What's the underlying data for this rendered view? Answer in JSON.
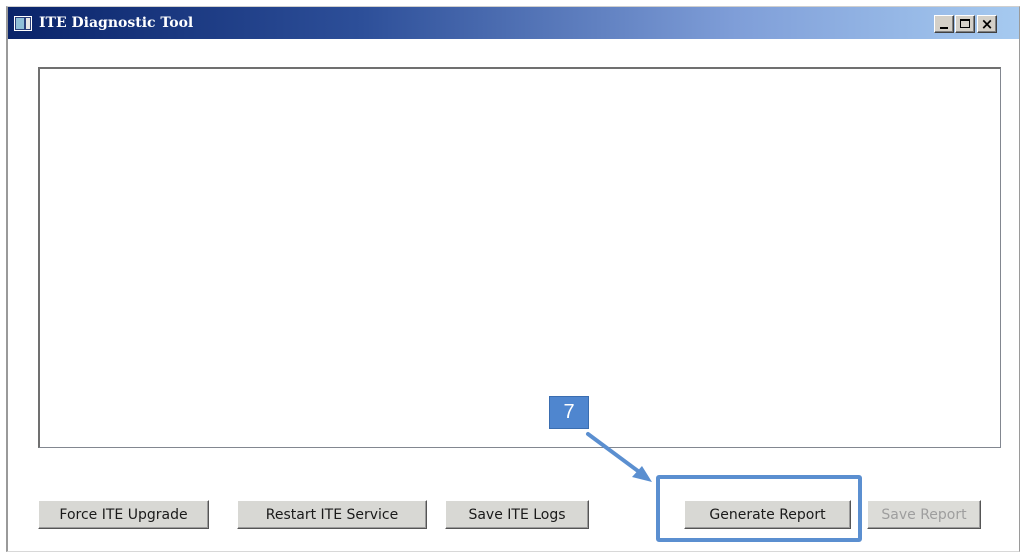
{
  "window": {
    "title": "ITE Diagnostic Tool",
    "controls": {
      "minimize_icon": "minimize-icon",
      "maximize_icon": "maximize-icon",
      "close_icon": "close-icon",
      "close_glyph": "×"
    }
  },
  "output": {
    "value": ""
  },
  "buttons": {
    "force_upgrade": "Force ITE Upgrade",
    "restart_service": "Restart ITE Service",
    "save_logs": "Save ITE Logs",
    "generate_report": "Generate Report",
    "save_report": "Save Report"
  },
  "button_states": {
    "save_report_enabled": false
  },
  "annotation": {
    "step_number": "7",
    "highlight_color": "#5b8fd0",
    "badge_color": "#4f86cf"
  },
  "colors": {
    "titlebar_start": "#0a246a",
    "titlebar_end": "#a6caf0",
    "button_face": "#d8d8d4"
  }
}
